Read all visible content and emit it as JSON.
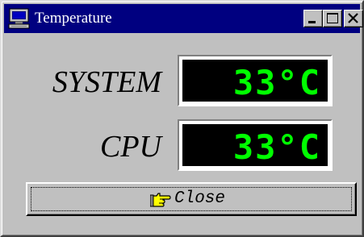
{
  "window": {
    "title": "Temperature",
    "title_icon": "computer-icon",
    "controls": [
      "minimize-icon",
      "maximize-icon",
      "close-icon"
    ]
  },
  "readings": [
    {
      "label": "SYSTEM",
      "value": "33",
      "unit": "°C"
    },
    {
      "label": "CPU",
      "value": "33",
      "unit": "°C"
    }
  ],
  "close_button": {
    "label": "Close",
    "icon": "pointing-hand-icon"
  },
  "colors": {
    "titlebar": "#000080",
    "window_face": "#c0c0c0",
    "lcd_background": "#000000",
    "lcd_digits": "#00ff00"
  }
}
